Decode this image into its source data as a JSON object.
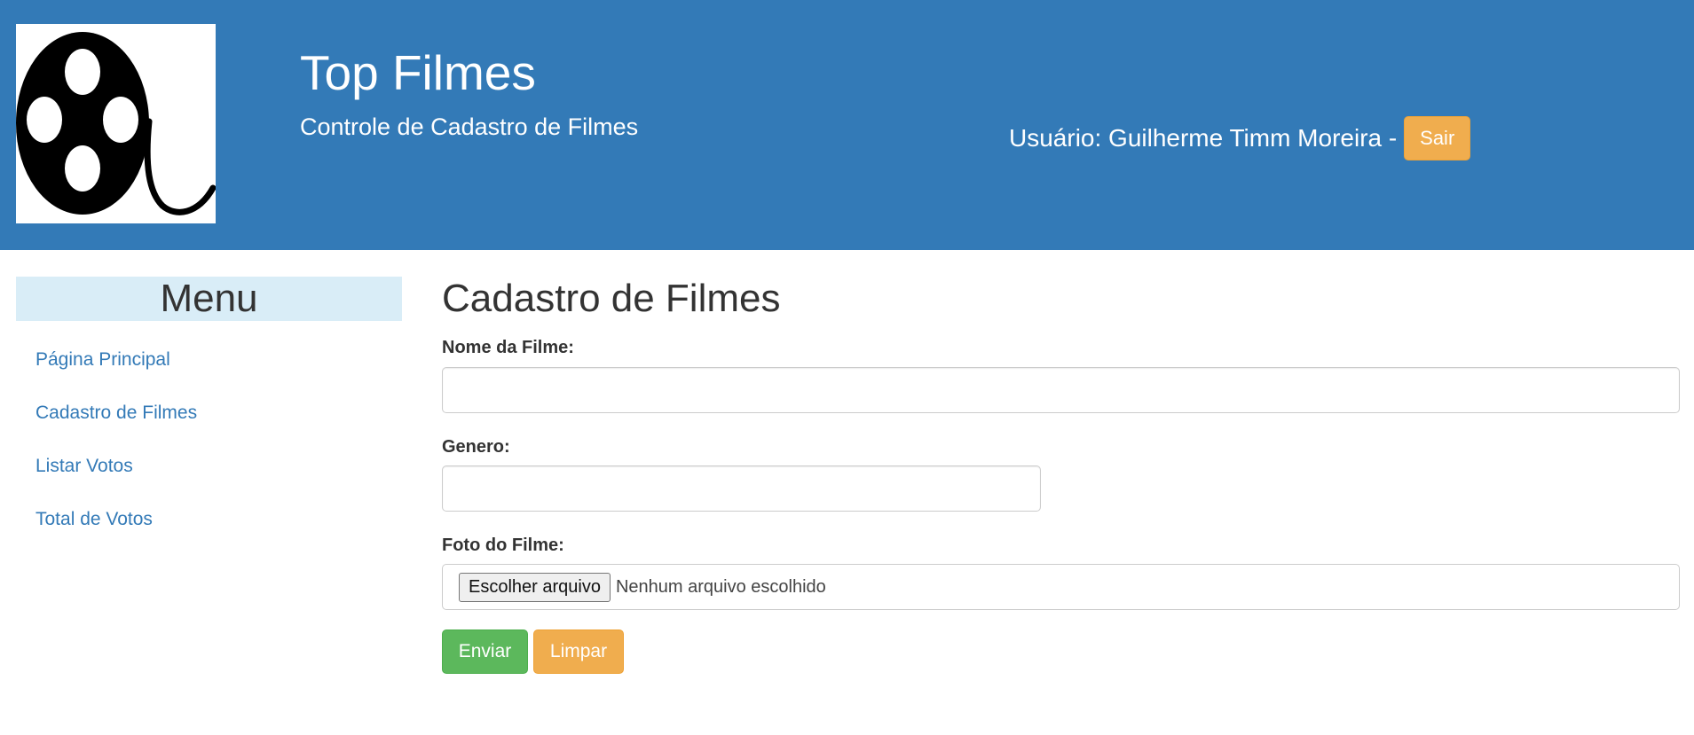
{
  "header": {
    "title": "Top Filmes",
    "subtitle": "Controle de Cadastro de Filmes",
    "logo_icon": "film-reel-icon",
    "user_text": "Usuário: Guilherme Timm Moreira -",
    "logout_label": "Sair",
    "background_color": "#337ab7"
  },
  "sidebar": {
    "title": "Menu",
    "items": [
      {
        "label": "Página Principal"
      },
      {
        "label": "Cadastro de Filmes"
      },
      {
        "label": "Listar Votos"
      },
      {
        "label": "Total de Votos"
      }
    ]
  },
  "form": {
    "title": "Cadastro de Filmes",
    "nome_label": "Nome da Filme:",
    "nome_value": "",
    "genero_label": "Genero:",
    "genero_value": "",
    "foto_label": "Foto do Filme:",
    "file_button_label": "Escolher arquivo",
    "file_status": "Nenhum arquivo escolhido",
    "submit_label": "Enviar",
    "reset_label": "Limpar"
  },
  "colors": {
    "primary": "#337ab7",
    "success": "#5cb85c",
    "warning": "#f0ad4e",
    "info_bg": "#d9edf7"
  }
}
